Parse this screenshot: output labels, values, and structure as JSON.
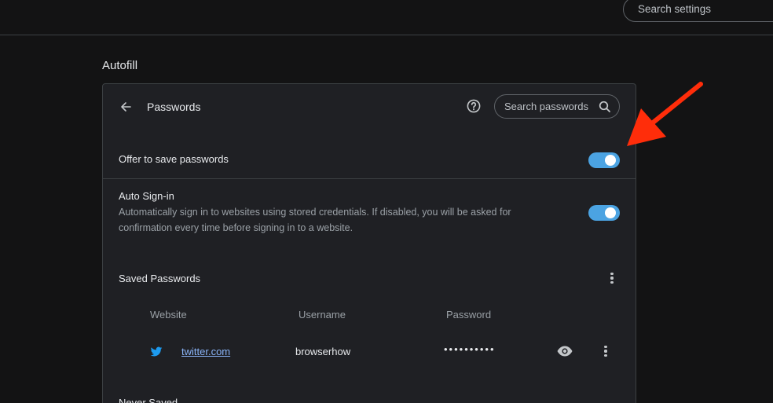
{
  "header": {
    "search_placeholder": "Search settings"
  },
  "section": {
    "title": "Autofill"
  },
  "passwords_page": {
    "title": "Passwords",
    "search_placeholder": "Search passwords"
  },
  "offer_to_save": {
    "label": "Offer to save passwords",
    "enabled": true
  },
  "auto_signin": {
    "label": "Auto Sign-in",
    "description_line1": "Automatically sign in to websites using stored credentials. If disabled, you will be asked for",
    "description_line2": "confirmation every time before signing in to a website.",
    "enabled": true
  },
  "saved_passwords": {
    "title": "Saved Passwords",
    "columns": [
      "Website",
      "Username",
      "Password"
    ],
    "entries": [
      {
        "site_icon": "twitter-bird-icon",
        "website": "twitter.com",
        "username": "browserhow",
        "password": "••••••••••"
      }
    ]
  },
  "never_saved": {
    "title": "Never Saved"
  },
  "colors": {
    "accent": "#4ba3e2",
    "annotation_arrow": "#ff2d0a",
    "card_bg": "#1f2024",
    "page_bg": "#131314",
    "link": "#8ab4f8"
  }
}
